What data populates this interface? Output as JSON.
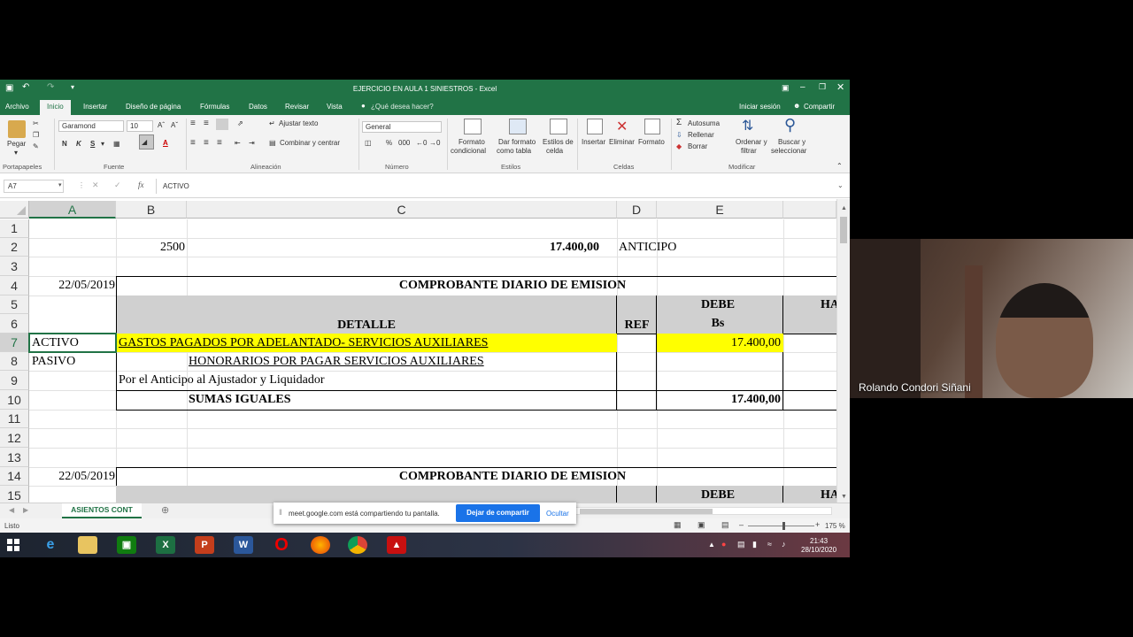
{
  "window": {
    "title": "EJERCICIO EN AULA 1 SINIESTROS - Excel"
  },
  "ribbon_tabs": [
    "Archivo",
    "Inicio",
    "Insertar",
    "Diseño de página",
    "Fórmulas",
    "Datos",
    "Revisar",
    "Vista"
  ],
  "tell_me": "¿Qué desea hacer?",
  "signin": "Iniciar sesión",
  "share": "Compartir",
  "ribbon": {
    "paste": "Pegar",
    "font_name": "Garamond",
    "font_size": "10",
    "bold": "N",
    "italic": "K",
    "underline": "S",
    "wrap_text": "Ajustar texto",
    "merge_center": "Combinar y centrar",
    "number_format": "General",
    "cond_format": [
      "Formato",
      "condicional"
    ],
    "format_table": [
      "Dar formato",
      "como tabla"
    ],
    "cell_styles": [
      "Estilos de",
      "celda"
    ],
    "insert": "Insertar",
    "delete": "Eliminar",
    "format": "Formato",
    "autosum": "Autosuma",
    "fill": "Rellenar",
    "clear": "Borrar",
    "sort_filter": [
      "Ordenar y",
      "filtrar"
    ],
    "find_select": [
      "Buscar y",
      "seleccionar"
    ],
    "groups": [
      "Portapapeles",
      "Fuente",
      "Alineación",
      "Número",
      "Estilos",
      "Celdas",
      "Modificar"
    ]
  },
  "formula_bar": {
    "name_box": "A7",
    "content": "ACTIVO",
    "fx": "fx"
  },
  "columns": [
    "A",
    "B",
    "C",
    "D",
    "E"
  ],
  "rows": [
    "1",
    "2",
    "3",
    "4",
    "5",
    "6",
    "7",
    "8",
    "9",
    "10",
    "11",
    "12",
    "13",
    "14",
    "15"
  ],
  "cells": {
    "B2": "2500",
    "C2": "17.400,00",
    "D2": "ANTICIPO",
    "A4": "22/05/2019",
    "header4": "COMPROBANTE DIARIO DE EMISION",
    "E5": "DEBE",
    "F5": "HA",
    "C6": "DETALLE",
    "D6": "REF",
    "E6": "Bs",
    "A7": "ACTIVO",
    "B7": "GASTOS PAGADOS POR ADELANTADO- SERVICIOS AUXILIARES",
    "E7": "17.400,00",
    "A8": "PASIVO",
    "B8": "HONORARIOS POR PAGAR SERVICIOS AUXILIARES",
    "B9": "Por el Anticipo al Ajustador y Liquidador",
    "B10": "SUMAS IGUALES",
    "E10": "17.400,00",
    "A14": "22/05/2019",
    "header14": "COMPROBANTE DIARIO DE EMISION",
    "E15": "DEBE",
    "F15": "HA"
  },
  "sheet_tab": "ASIENTOS CONT",
  "status": {
    "ready": "Listo",
    "zoom": "175 %"
  },
  "share_bar": {
    "message": "meet.google.com está compartiendo tu pantalla.",
    "stop": "Dejar de compartir",
    "hide": "Ocultar"
  },
  "taskbar": {
    "time": "21:43",
    "date": "28/10/2020"
  },
  "participant": {
    "name": "Rolando Condori Siñani"
  },
  "colors": {
    "excel_green": "#217346",
    "highlight": "#ffff00",
    "header_fill": "#d0d0d0",
    "share_blue": "#1a73e8"
  }
}
